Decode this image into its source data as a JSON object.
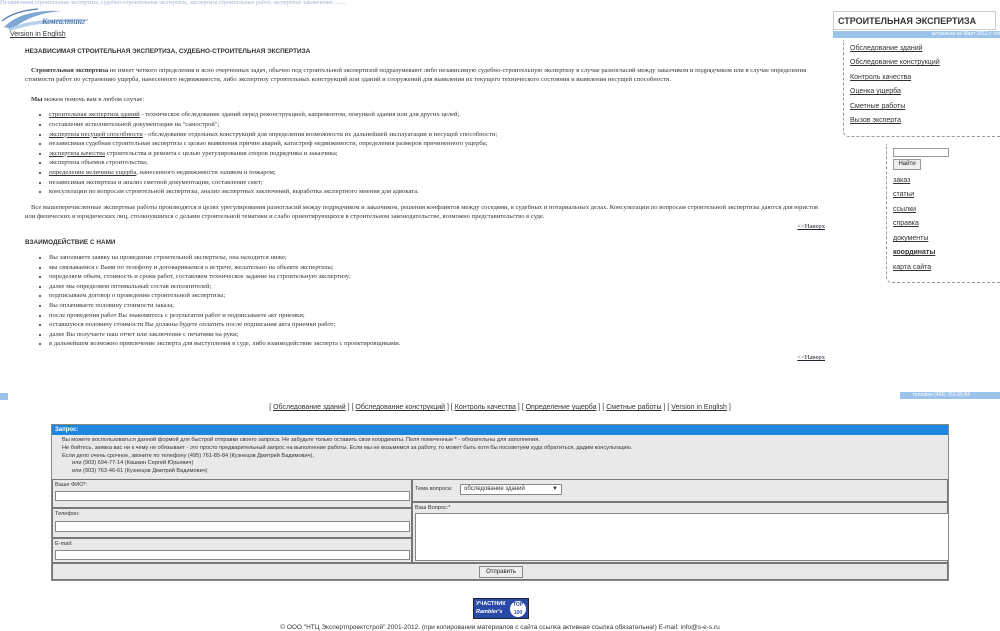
{
  "header": {
    "top_line": "Независимая строительная экспертиза, судебно-строительная экспертиза, экспертиза строительных работ, экспертное заключение.........",
    "logo_text": "Консалтинг",
    "version_link": "Version in English"
  },
  "main": {
    "heading1": "НЕЗАВИСИМАЯ СТРОИТЕЛЬНАЯ ЭКСПЕРТИЗА, СУДЕБНО-СТРОИТЕЛЬНАЯ ЭКСПЕРТИЗА",
    "intro_bold": "Строительная экспертиза",
    "intro_rest": " не имеет четкого определения и ясно очерченных задач, обычно под строительной экспертизой подразумевают либо независимую судебно-строительную экспертизу в случае разногласий между заказчиком и подрядчиком или в случае определения стоимости работ по устранению ущерба, нанесенного недвижимости, либо экспертизу строительных конструкций или зданий и сооружений для выявления их текущего технического состояния и выявления несущей способности.",
    "help_bold": "Мы",
    "help_rest": " можем помочь вам в любом случае:",
    "services": [
      {
        "link": "строительная экспертиза зданий",
        "text": " - техническое обследование зданий перед реконструкцией, капремонтом, покупкой здания или для других целей;"
      },
      {
        "link": "",
        "text": "составление исполнительной документации на \"самострой\";"
      },
      {
        "link": "экспертиза несущей способности",
        "text": " - обследование отдельных конструкций для определения возможности их дальнейшей эксплуатации и несущей способности;"
      },
      {
        "link": "",
        "text": "независимая судебная строительная экспертиза с целью выявления причин аварий, катастроф недвижимости, определения размеров причиненного ущерба;"
      },
      {
        "link": "экспертиза качества",
        "text": " строительства и ремонта с целью урегулирования споров подрядчика и заказчика;"
      },
      {
        "link": "",
        "text": "экспертиза объемов строительства;"
      },
      {
        "link": "определение величины ущерба",
        "text": ", нанесенного недвижимости заливом и пожаром;"
      },
      {
        "link": "",
        "text": "независимая экспертиза и анализ сметной документации, составление смет;"
      },
      {
        "link": "",
        "text": "консультации по вопросам строительной экспертизы, анализ экспертных заключений, выработка экспертного мнения для адвоката."
      }
    ],
    "summary": "Все вышеперечисленные экспертные работы производятся в целях урегулирования разногласий между подрядчиком и заказчиком, решения конфликтов между соседями, в судебных и нотариальных делах. Консультации по вопросам строительной экспертизы даются для юристов или физических и юридических лиц, столкнувшихся с делами строительной тематики и слабо ориентирующихся в строительном законодательстве, возможно представительство в суде.",
    "back_link": "<<Наверх",
    "heading2": "ВЗАИМОДЕЙСТВИЕ С НАМИ",
    "steps": [
      "Вы заполняете заявку на проведение строительной экспертизы, она находится ниже;",
      "мы связываемся с Вами по телефону и договариваемся о встрече, желательно на объекте экспертизы;",
      "определяем объем, стоимость и сроки работ, составляем техническое задание на строительную экспертизу;",
      "далее мы определяем оптимальный состав исполнителей;",
      "подписываем договор о проведении строительной экспертизы;",
      "Вы оплачиваете половину стоимости заказа;",
      "после проведения работ Вы знакомитесь с результатом работ и подписываете акт приемки;",
      "оставшуюся половину стоимости Вы должны будете оплатить после подписания акта приемки работ;",
      "далее Вы получаете наш отчет или заключение с печатями на руки;",
      "в дальнейшем возможно привлечение эксперта для выступления в суде, либо взаимодействие эксперта с проектировщиками."
    ],
    "back_link2": "<<Наверх"
  },
  "sidebar": {
    "title": "СТРОИТЕЛЬНАЯ ЭКСПЕРТИЗА",
    "bar_text": "актуально на Март 2012 г. ext",
    "nav": [
      "Обследование зданий",
      "Обследование конструкций",
      "Контроль качества",
      "Оценка ущерба",
      "Сметные работы",
      "Вызов эксперта"
    ],
    "search_button": "Найти",
    "links": [
      "заказ",
      "статьи",
      "ссылки",
      "справка",
      "документы",
      "координаты",
      "карта сайта"
    ]
  },
  "phone_bar": "телефон (495) 761-85-84",
  "footer_nav": [
    "Обследование зданий",
    "Обследование конструкций",
    "Контроль качества",
    "Определение ущерба",
    "Сметные работы",
    "Version in English"
  ],
  "form": {
    "header": "Запрос:",
    "info": [
      "Вы можете воспользоваться данной формой для быстрой отправки своего запроса. Не забудьте только оставить свои координаты. Поля помеченные * - обязательны для заполнения.",
      "Не бойтесь, заявка вас ни к чему не обязывает - это просто предварительный запрос на выполнение работы. Если мы не возьмемся за работу, то может быть хотя бы посоветуем куда обратиться, дадим консультацию.",
      "Если дело очень срочное, звоните по телефону (495) 761-85-84 (Кузнецов Дмитрий Вадимович),",
      "или (903) 694-77-14 (Кашкин Сергей Юрьевич)",
      "или (903) 763-46-61 (Кузнецов Дмитрий Вадимович)"
    ],
    "name_label": "Ваше ФИО*:",
    "topic_label": "Тема вопроса:",
    "topic_value": "обследование зданий",
    "phone_label": "Телефон:",
    "question_label": "Ваш Вопрос:*",
    "email_label": "E-mail:",
    "submit": "Отправить"
  },
  "badge": {
    "line1": "УЧАСТНИК",
    "line2": "Rambler's",
    "line3": "TOP 100"
  },
  "copyright": "© ООО \"НТЦ Экспертпроектстрой\" 2001-2012. (при копировании материалов с сайта ссылка активная ссылка обязательна!) E-mail: info@s-e-s.ru"
}
